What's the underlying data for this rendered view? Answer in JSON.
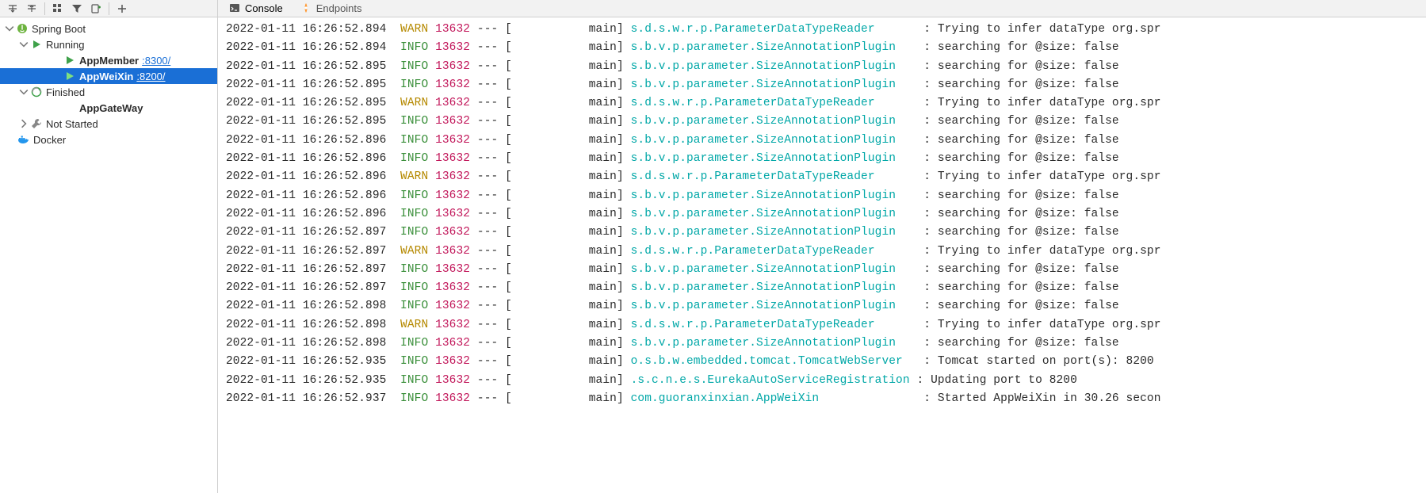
{
  "toolbar_buttons": [
    "collapse",
    "expand",
    "group",
    "filter",
    "add-config",
    "new"
  ],
  "tabs": [
    {
      "id": "console",
      "label": "Console",
      "active": true
    },
    {
      "id": "endpoints",
      "label": "Endpoints",
      "active": false
    }
  ],
  "tree": {
    "root": {
      "label": "Spring Boot"
    },
    "running": {
      "label": "Running"
    },
    "app_member": {
      "label": "AppMember",
      "port": ":8300/",
      "bold": true
    },
    "app_weixin": {
      "label": "AppWeiXin",
      "port": ":8200/",
      "bold": true,
      "selected": true
    },
    "finished": {
      "label": "Finished"
    },
    "app_gateway": {
      "label": "AppGateWay",
      "bold": true
    },
    "not_started": {
      "label": "Not Started"
    },
    "docker": {
      "label": "Docker"
    }
  },
  "log_columns": {
    "pid": "13632",
    "dashes": "---",
    "thread": "main"
  },
  "log_lines": [
    {
      "ts": "2022-01-11 16:26:52.894",
      "level": "WARN",
      "logger": "s.d.s.w.r.p.ParameterDataTypeReader       ",
      "msg": "Trying to infer dataType org.spr"
    },
    {
      "ts": "2022-01-11 16:26:52.894",
      "level": "INFO",
      "logger": "s.b.v.p.parameter.SizeAnnotationPlugin    ",
      "msg": "searching for @size: false"
    },
    {
      "ts": "2022-01-11 16:26:52.895",
      "level": "INFO",
      "logger": "s.b.v.p.parameter.SizeAnnotationPlugin    ",
      "msg": "searching for @size: false"
    },
    {
      "ts": "2022-01-11 16:26:52.895",
      "level": "INFO",
      "logger": "s.b.v.p.parameter.SizeAnnotationPlugin    ",
      "msg": "searching for @size: false"
    },
    {
      "ts": "2022-01-11 16:26:52.895",
      "level": "WARN",
      "logger": "s.d.s.w.r.p.ParameterDataTypeReader       ",
      "msg": "Trying to infer dataType org.spr"
    },
    {
      "ts": "2022-01-11 16:26:52.895",
      "level": "INFO",
      "logger": "s.b.v.p.parameter.SizeAnnotationPlugin    ",
      "msg": "searching for @size: false"
    },
    {
      "ts": "2022-01-11 16:26:52.896",
      "level": "INFO",
      "logger": "s.b.v.p.parameter.SizeAnnotationPlugin    ",
      "msg": "searching for @size: false"
    },
    {
      "ts": "2022-01-11 16:26:52.896",
      "level": "INFO",
      "logger": "s.b.v.p.parameter.SizeAnnotationPlugin    ",
      "msg": "searching for @size: false"
    },
    {
      "ts": "2022-01-11 16:26:52.896",
      "level": "WARN",
      "logger": "s.d.s.w.r.p.ParameterDataTypeReader       ",
      "msg": "Trying to infer dataType org.spr"
    },
    {
      "ts": "2022-01-11 16:26:52.896",
      "level": "INFO",
      "logger": "s.b.v.p.parameter.SizeAnnotationPlugin    ",
      "msg": "searching for @size: false"
    },
    {
      "ts": "2022-01-11 16:26:52.896",
      "level": "INFO",
      "logger": "s.b.v.p.parameter.SizeAnnotationPlugin    ",
      "msg": "searching for @size: false"
    },
    {
      "ts": "2022-01-11 16:26:52.897",
      "level": "INFO",
      "logger": "s.b.v.p.parameter.SizeAnnotationPlugin    ",
      "msg": "searching for @size: false"
    },
    {
      "ts": "2022-01-11 16:26:52.897",
      "level": "WARN",
      "logger": "s.d.s.w.r.p.ParameterDataTypeReader       ",
      "msg": "Trying to infer dataType org.spr"
    },
    {
      "ts": "2022-01-11 16:26:52.897",
      "level": "INFO",
      "logger": "s.b.v.p.parameter.SizeAnnotationPlugin    ",
      "msg": "searching for @size: false"
    },
    {
      "ts": "2022-01-11 16:26:52.897",
      "level": "INFO",
      "logger": "s.b.v.p.parameter.SizeAnnotationPlugin    ",
      "msg": "searching for @size: false"
    },
    {
      "ts": "2022-01-11 16:26:52.898",
      "level": "INFO",
      "logger": "s.b.v.p.parameter.SizeAnnotationPlugin    ",
      "msg": "searching for @size: false"
    },
    {
      "ts": "2022-01-11 16:26:52.898",
      "level": "WARN",
      "logger": "s.d.s.w.r.p.ParameterDataTypeReader       ",
      "msg": "Trying to infer dataType org.spr"
    },
    {
      "ts": "2022-01-11 16:26:52.898",
      "level": "INFO",
      "logger": "s.b.v.p.parameter.SizeAnnotationPlugin    ",
      "msg": "searching for @size: false"
    },
    {
      "ts": "2022-01-11 16:26:52.935",
      "level": "INFO",
      "logger": "o.s.b.w.embedded.tomcat.TomcatWebServer   ",
      "msg": "Tomcat started on port(s): 8200 "
    },
    {
      "ts": "2022-01-11 16:26:52.935",
      "level": "INFO",
      "logger": ".s.c.n.e.s.EurekaAutoServiceRegistration ",
      "msg": "Updating port to 8200"
    },
    {
      "ts": "2022-01-11 16:26:52.937",
      "level": "INFO",
      "logger": "com.guoranxinxian.AppWeiXin               ",
      "msg": "Started AppWeiXin in 30.26 secon"
    }
  ],
  "colors": {
    "warn": "#b58900",
    "info": "#3a8f3a",
    "pid": "#c2185b",
    "logger": "#00a7a7",
    "selected_bg": "#1a6fd6"
  }
}
